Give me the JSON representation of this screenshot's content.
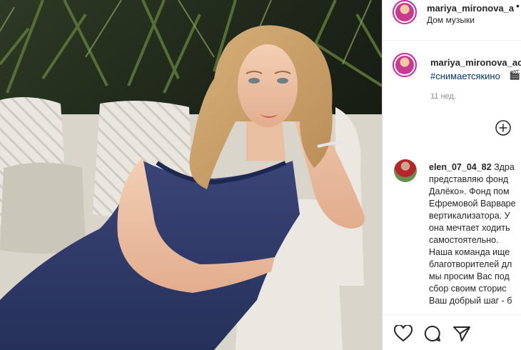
{
  "post": {
    "username": "mariya_mironova_a",
    "more_icon": "more-dots-icon",
    "location": "Дом музыки"
  },
  "caption": {
    "username": "mariya_mironova_ac",
    "hashtag": "#снимаетсякино",
    "emoji": "🎬",
    "time": "11 нед."
  },
  "comment": {
    "username": "elen_07_04_82",
    "lines": [
      "Здра",
      "представляю фонд",
      "Далёко». Фонд пом",
      "Ефремовой Варваре",
      "вертикализатора. У",
      "она мечтает ходить",
      "самостоятельно.",
      "Наша команда ище",
      "благотворителей дл",
      "мы просим Вас под",
      "сбор своим сторис",
      "Ваш добрый шаг - б"
    ]
  },
  "actions": {
    "like_icon": "heart-icon",
    "comment_icon": "comment-icon",
    "share_icon": "share-icon"
  },
  "colors": {
    "username": "#262626",
    "hashtag": "#00376b",
    "meta": "#8e8e8e",
    "dress": "#2f3a66",
    "sofa": "#e6e2d9"
  }
}
